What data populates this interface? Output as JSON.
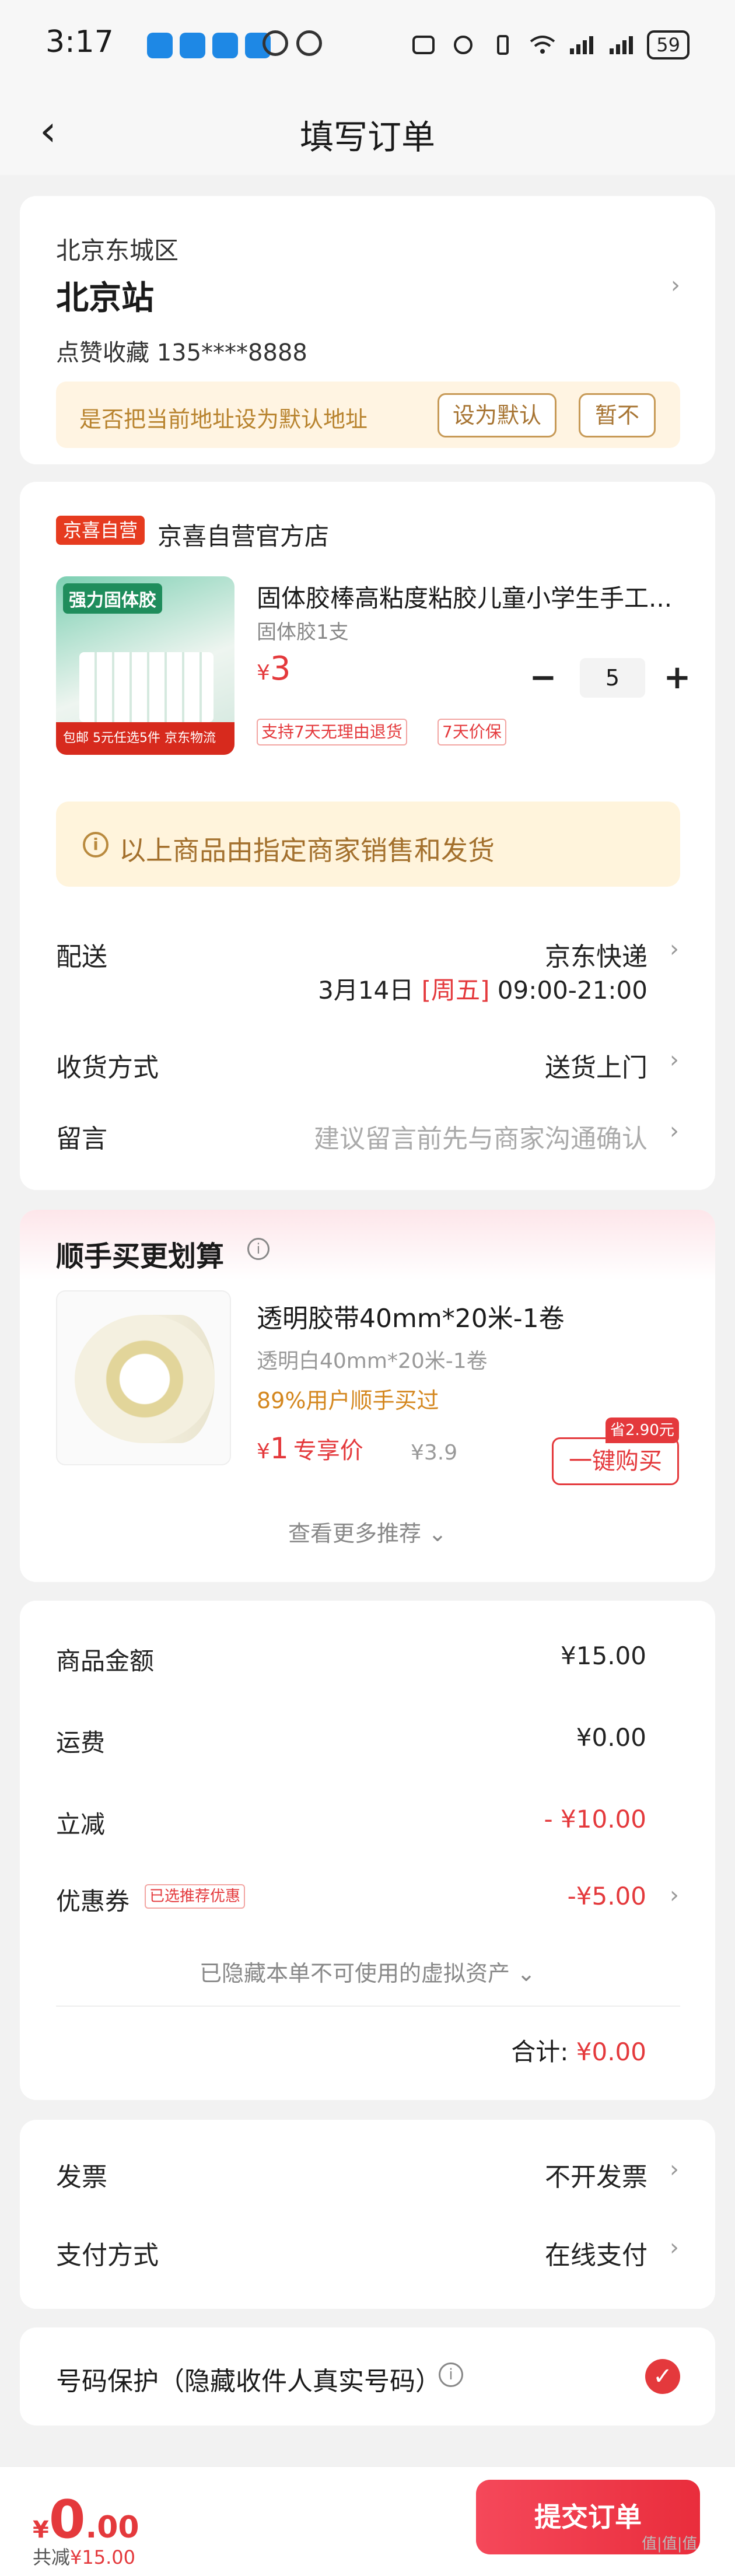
{
  "status_bar": {
    "time": "3:17",
    "battery": "59"
  },
  "nav": {
    "title": "填写订单"
  },
  "address": {
    "region": "北京东城区",
    "name": "北京站",
    "contact": "点赞收藏  135****8888",
    "default_prompt": "是否把当前地址设为默认地址",
    "set_default": "设为默认",
    "not_now": "暂不"
  },
  "shop": {
    "tag": "京喜自营",
    "name": "京喜自营官方店",
    "product": {
      "image_label": "强力固体胶",
      "image_badge": "5元任选5件  京东物流",
      "image_corner": "包邮",
      "title": "固体胶棒高粘度粘胶儿童小学生手工...",
      "spec": "固体胶1支",
      "price_symbol": "¥",
      "price": "3",
      "qty": "5",
      "tags": [
        "支持7天无理由退货",
        "7天价保"
      ]
    },
    "notice": "以上商品由指定商家销售和发货",
    "delivery_label": "配送",
    "delivery_value": "京东快递",
    "delivery_date": "3月14日",
    "delivery_day": "[周五]",
    "delivery_time": "09:00-21:00",
    "receive_label": "收货方式",
    "receive_value": "送货上门",
    "note_label": "留言",
    "note_placeholder": "建议留言前先与商家沟通确认"
  },
  "upsell": {
    "title": "顺手买更划算",
    "name": "透明胶带40mm*20米-1卷",
    "spec": "透明白40mm*20米-1卷",
    "buyers": "89%用户顺手买过",
    "price_symbol": "¥",
    "price": "1",
    "price_note": "专享价",
    "old_price": "¥3.9",
    "save_tag": "省2.90元",
    "buy_button": "一键购买",
    "more": "查看更多推荐 ⌄"
  },
  "amounts": {
    "goods_label": "商品金额",
    "goods_value": "¥15.00",
    "ship_label": "运费",
    "ship_value": "¥0.00",
    "discount_label": "立减",
    "discount_value": "- ¥10.00",
    "coupon_label": "优惠券",
    "coupon_tag": "已选推荐优惠",
    "coupon_value": "-¥5.00",
    "hidden_assets": "已隐藏本单不可使用的虚拟资产 ⌄",
    "total_label": "合计:",
    "total_value": "¥0.00"
  },
  "invoice": {
    "invoice_label": "发票",
    "invoice_value": "不开发票",
    "pay_label": "支付方式",
    "pay_value": "在线支付"
  },
  "privacy": {
    "label": "号码保护（隐藏收件人真实号码）"
  },
  "bottom_bar": {
    "yen": "¥",
    "int": "0",
    "dec": ".00",
    "saved_label": "共减",
    "saved_value": "¥15.00",
    "submit": "提交订单"
  },
  "watermark": "值|值|值",
  "colors": {
    "accent": "#e4393c",
    "gold": "#b8832e"
  }
}
